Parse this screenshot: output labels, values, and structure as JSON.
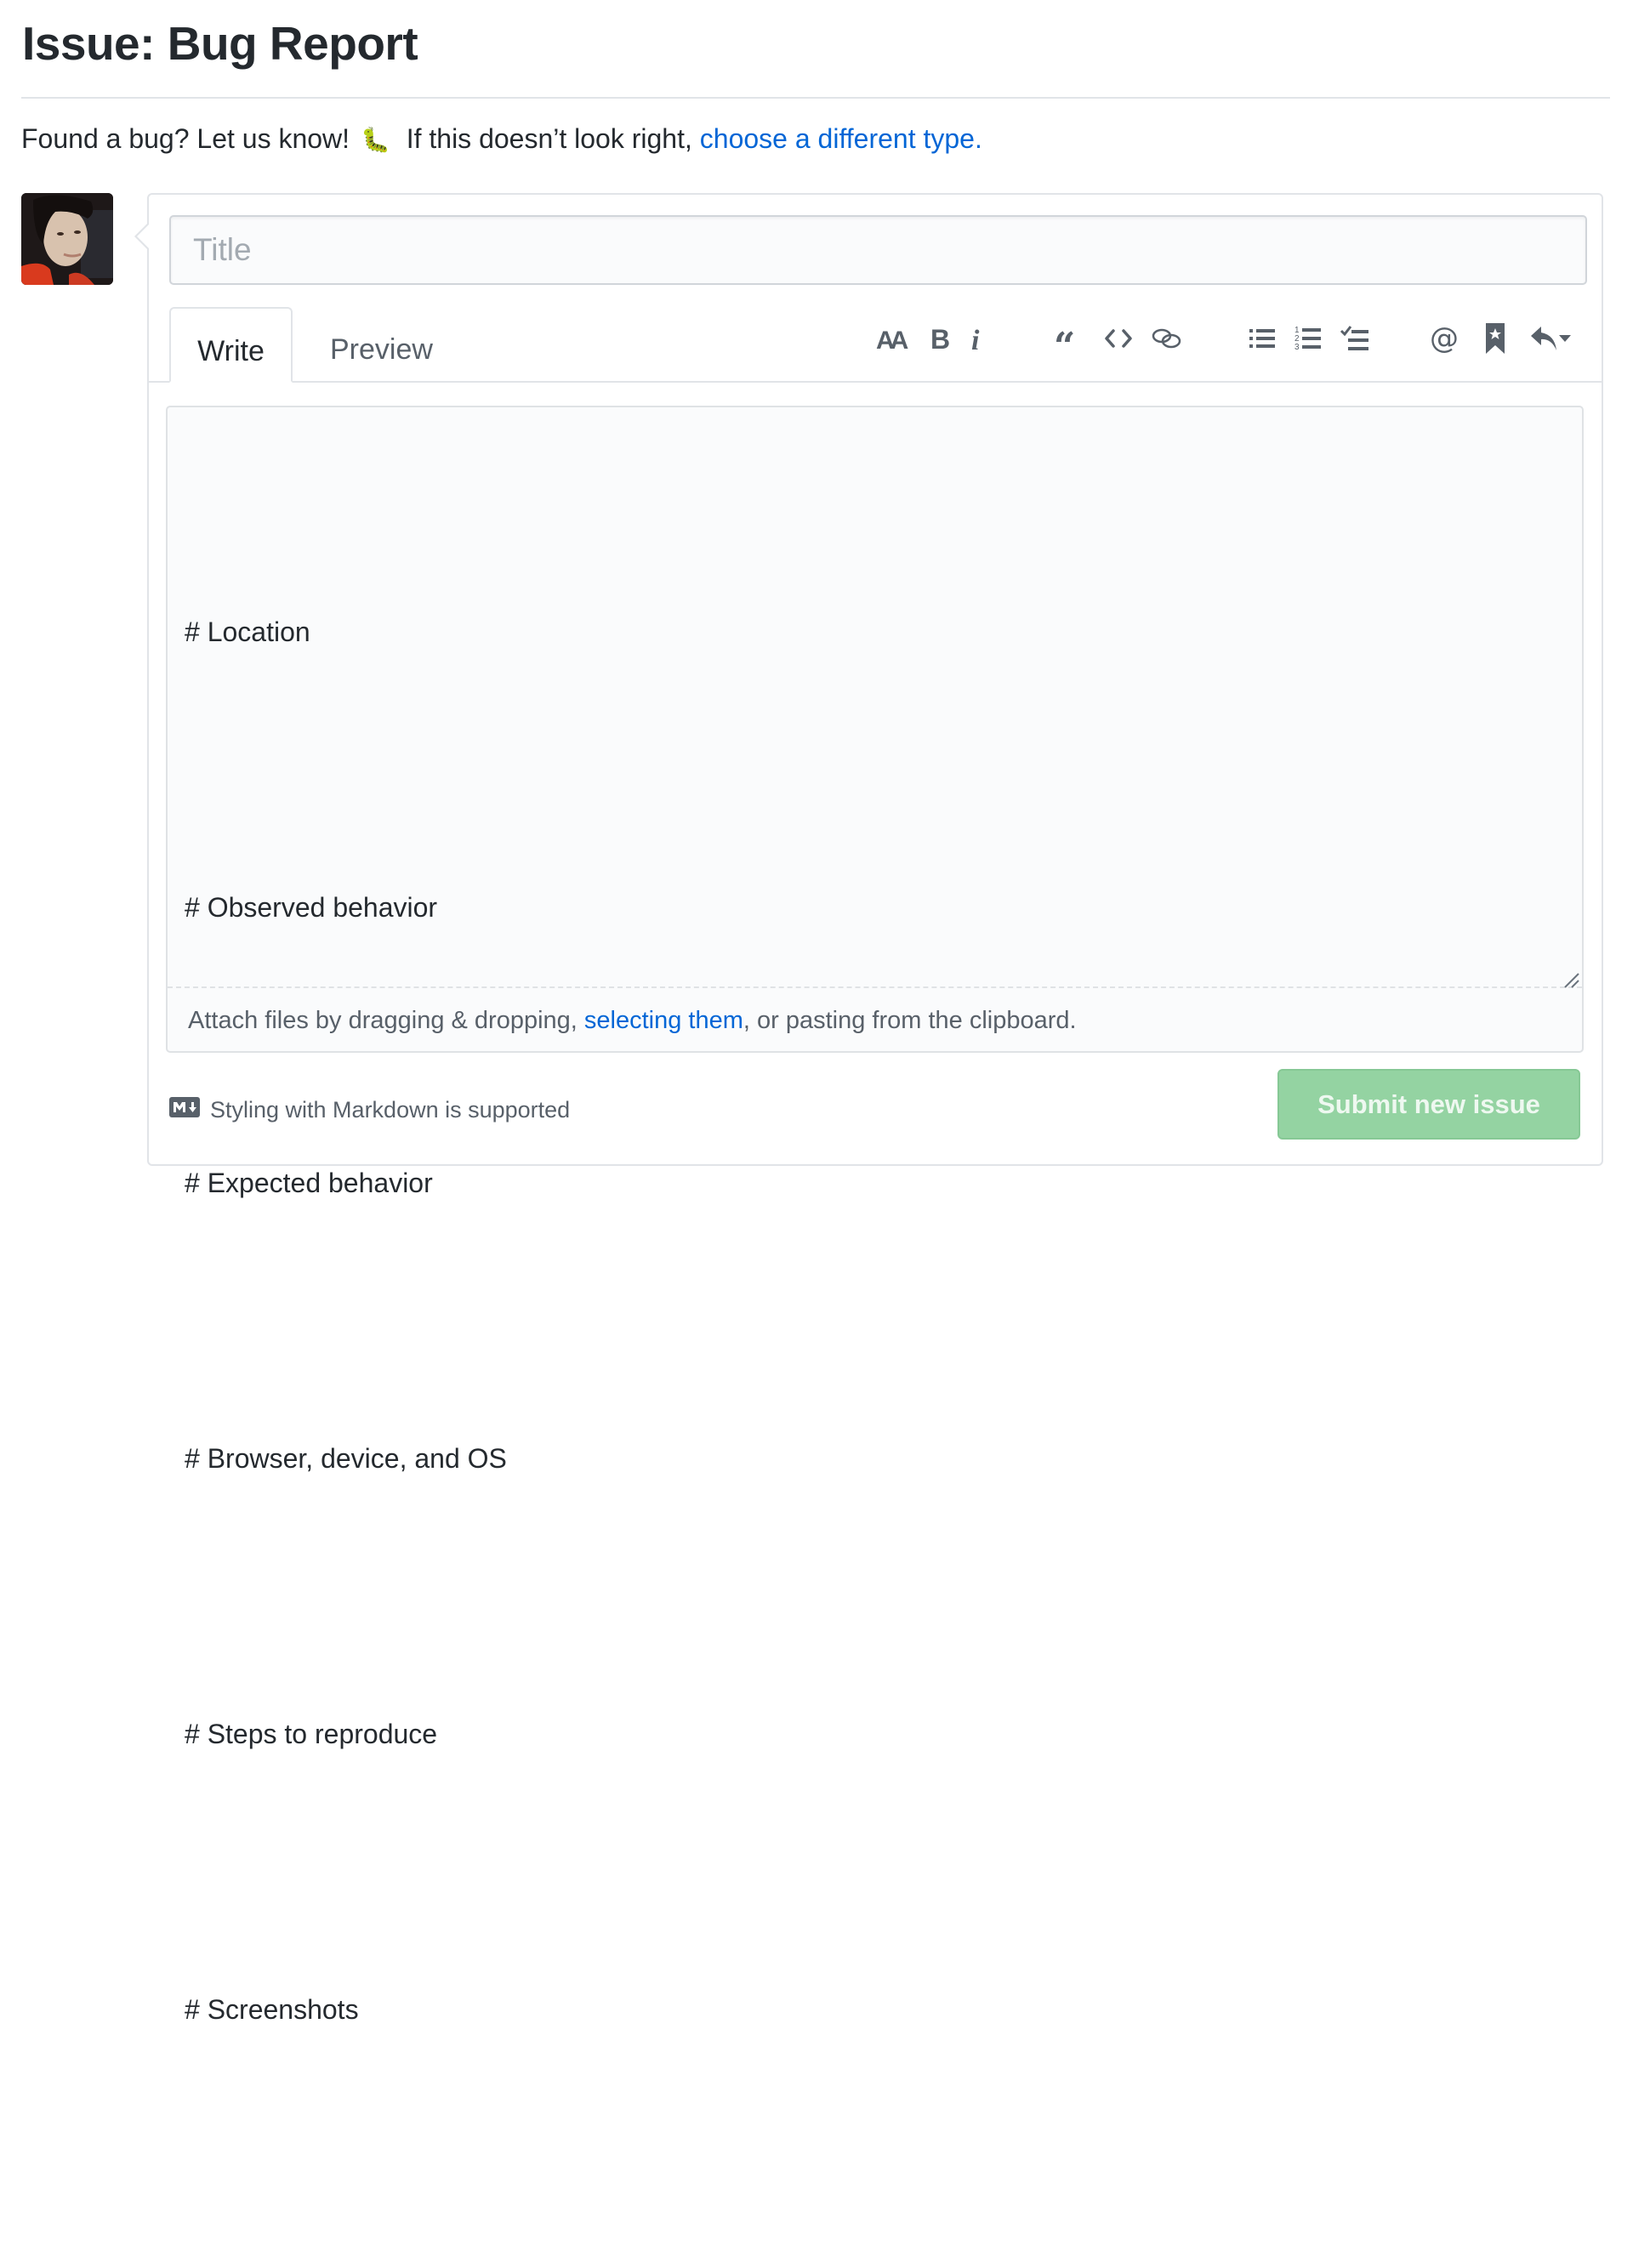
{
  "page": {
    "title": "Issue: Bug Report",
    "intro_text": "Found a bug? Let us know!",
    "intro_emoji": "🐛",
    "intro_suffix": "If this doesn’t look right,",
    "intro_link": "choose a different type."
  },
  "avatar": {
    "alt": "User avatar"
  },
  "form": {
    "title_placeholder": "Title",
    "title_value": "",
    "tabs": [
      {
        "label": "Write",
        "active": true
      },
      {
        "label": "Preview",
        "active": false
      }
    ],
    "toolbar": [
      {
        "icon": "text-size-icon",
        "label": "Add header text"
      },
      {
        "icon": "bold-icon",
        "label": "Add bold text"
      },
      {
        "icon": "italic-icon",
        "label": "Add italic text"
      },
      {
        "icon": "quote-icon",
        "label": "Insert a quote"
      },
      {
        "icon": "code-icon",
        "label": "Insert code"
      },
      {
        "icon": "link-icon",
        "label": "Add a link"
      },
      {
        "icon": "list-unordered-icon",
        "label": "Add a bulleted list"
      },
      {
        "icon": "list-ordered-icon",
        "label": "Add a numbered list"
      },
      {
        "icon": "tasklist-icon",
        "label": "Add a task list"
      },
      {
        "icon": "mention-icon",
        "label": "Directly mention a user or team"
      },
      {
        "icon": "bookmark-icon",
        "label": "Reference an issue or pull request"
      },
      {
        "icon": "reply-icon",
        "label": "Insert a reply"
      }
    ],
    "body_lines": [
      "# Location",
      "# Observed behavior",
      "# Expected behavior",
      "# Browser, device, and OS",
      "# Steps to reproduce",
      "# Screenshots"
    ],
    "attach_prefix": "Attach files by dragging & dropping, ",
    "attach_link": "selecting them",
    "attach_suffix": ", or pasting from the clipboard.",
    "markdown_note": "Styling with Markdown is supported",
    "submit_label": "Submit new issue"
  },
  "colors": {
    "link": "#0366d6",
    "submit_disabled_bg": "#94d3a2",
    "icon": "#586069",
    "text": "#24292e"
  }
}
